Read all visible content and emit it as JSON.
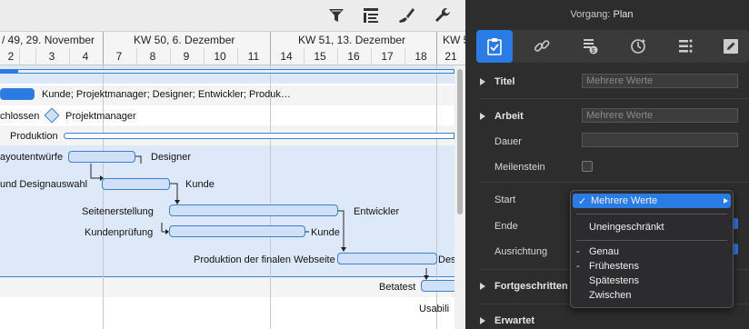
{
  "toolbar": {
    "icons": [
      "filter-icon",
      "outline-icon",
      "brush-icon",
      "wrench-icon"
    ]
  },
  "timeline": {
    "weeks": [
      "/ 49, 29. November",
      "KW 50, 6. Dezember",
      "KW 51, 13. Dezember",
      "KW 5"
    ],
    "days": [
      "2",
      "3",
      "4",
      "7",
      "8",
      "9",
      "10",
      "11",
      "14",
      "15",
      "16",
      "17",
      "18",
      "21"
    ]
  },
  "tasks": {
    "kunde_resources": "Kunde; Projektmanager; Designer; Entwickler; Produk…",
    "abgeschlossen": "chlossen",
    "projektmanager": "Projektmanager",
    "produktion": "Produktion",
    "layoutentwuerfe": "ayoutentwürfe",
    "designer": "Designer",
    "designauswahl": "und Designauswahl",
    "kunde1": "Kunde",
    "seitenerstellung": "Seitenerstellung",
    "entwickler": "Entwickler",
    "kundenpruefung": "Kundenprüfung",
    "kunde2": "Kunde",
    "produktion_final": "Produktion der finalen Webseite",
    "des": "Des",
    "betatest": "Betatest",
    "usabili": "Usabili"
  },
  "inspector": {
    "title_prefix": "Vorgang:",
    "title_value": "Plan",
    "tabs": [
      "task-clipboard-icon",
      "link-icon",
      "cost-icon",
      "recurrence-icon",
      "list-icon",
      "note-icon"
    ],
    "titel_label": "Titel",
    "titel_placeholder": "Mehrere Werte",
    "arbeit_label": "Arbeit",
    "arbeit_placeholder": "Mehrere Werte",
    "dauer_label": "Dauer",
    "meilenstein_label": "Meilenstein",
    "start_label": "Start",
    "ende_label": "Ende",
    "ausrichtung_label": "Ausrichtung",
    "fortgeschritten_label": "Fortgeschritten",
    "erwartet_label": "Erwartet"
  },
  "dropdown": {
    "selected": "Mehrere Werte",
    "checkmark": "✓",
    "option_uneingeschraenkt": "Uneingeschränkt",
    "options": [
      {
        "mark": "-",
        "label": "Genau"
      },
      {
        "mark": "-",
        "label": "Frühestens"
      },
      {
        "mark": "",
        "label": "Spätestens"
      },
      {
        "mark": "",
        "label": "Zwischen"
      }
    ]
  },
  "colors": {
    "accent": "#2a7be4",
    "bar_border": "#3f7fd0",
    "bar_fill": "#cfe0f7",
    "selection": "#dde9f8"
  }
}
